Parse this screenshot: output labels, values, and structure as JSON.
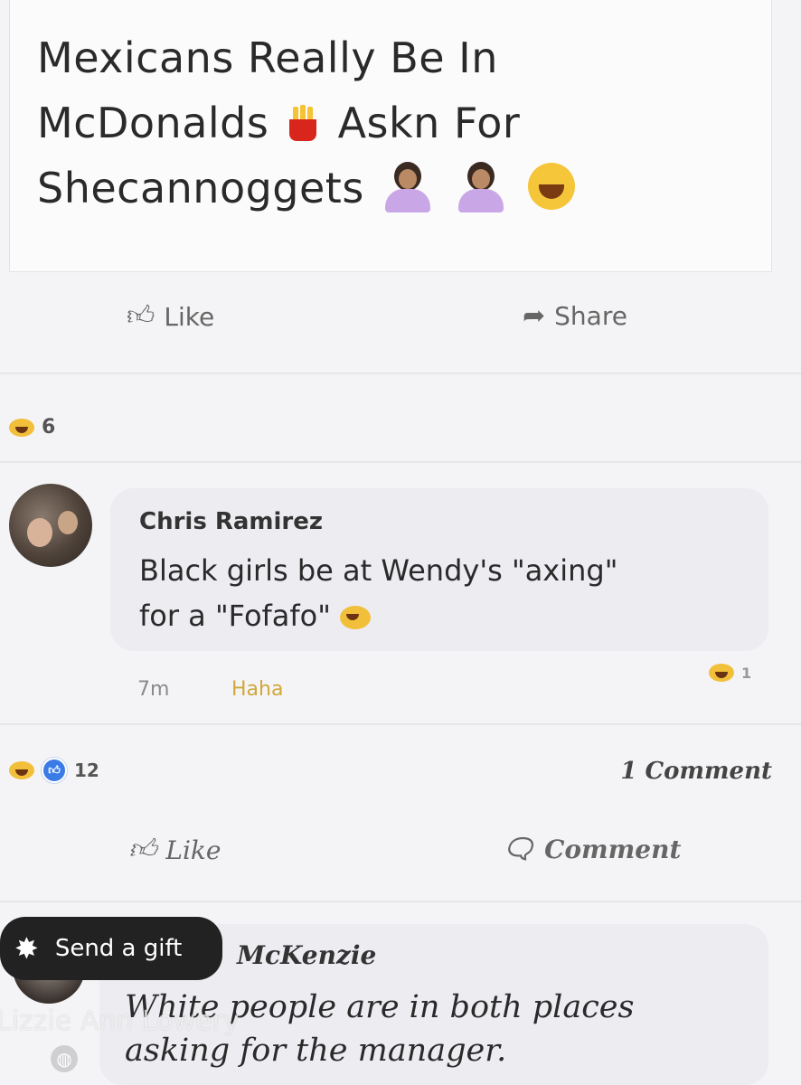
{
  "post": {
    "line1": "Mexicans Really Be In",
    "line2a": "McDonalds",
    "line2b": "Askn For",
    "line3": "Shecannoggets"
  },
  "actions_top": {
    "like": "Like",
    "share": "Share"
  },
  "post_reactions": {
    "count": "6"
  },
  "comment1": {
    "author": "Chris Ramirez",
    "text_line1": "Black girls be at Wendy's \"axing\"",
    "text_line2": "for a \"Fofafo\"",
    "time": "7m",
    "reaction_label": "Haha",
    "reaction_count": "1"
  },
  "summary": {
    "reaction_count": "12",
    "comments": "1 Comment"
  },
  "actions_bottom": {
    "like": "Like",
    "comment": "Comment"
  },
  "gift_button": {
    "label": "Send a gift"
  },
  "comment2": {
    "author": "McKenzie",
    "text_line1": "White people are in both places",
    "text_line2": "asking for the manager."
  },
  "watermark": "Lizzie Ann Lowery",
  "icons": [
    "fries-icon",
    "facepalm-icon",
    "shrug-icon",
    "laughing-icon",
    "thumbs-up-icon",
    "share-arrow-icon",
    "comment-bubble-icon",
    "gift-icon",
    "globe-icon"
  ]
}
